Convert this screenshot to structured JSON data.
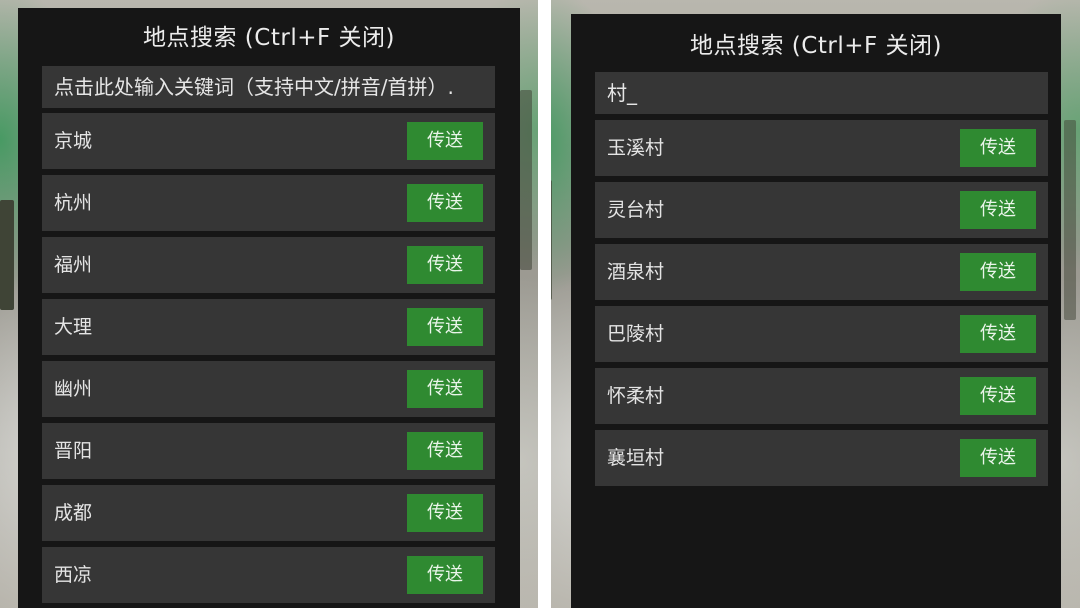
{
  "left_panel": {
    "title": "地点搜索 (Ctrl+F 关闭)",
    "search_text": "点击此处输入关键词（支持中文/拼音/首拼）.",
    "items": [
      {
        "label": "京城",
        "button": "传送"
      },
      {
        "label": "杭州",
        "button": "传送"
      },
      {
        "label": "福州",
        "button": "传送"
      },
      {
        "label": "大理",
        "button": "传送"
      },
      {
        "label": "幽州",
        "button": "传送"
      },
      {
        "label": "晋阳",
        "button": "传送"
      },
      {
        "label": "成都",
        "button": "传送"
      },
      {
        "label": "西凉",
        "button": "传送"
      }
    ]
  },
  "right_panel": {
    "title": "地点搜索 (Ctrl+F 关闭)",
    "search_text": "村_",
    "items": [
      {
        "label": "玉溪村",
        "button": "传送"
      },
      {
        "label": "灵台村",
        "button": "传送"
      },
      {
        "label": "酒泉村",
        "button": "传送"
      },
      {
        "label": "巴陵村",
        "button": "传送"
      },
      {
        "label": "怀柔村",
        "button": "传送"
      },
      {
        "label": "襄垣村",
        "button": "传送"
      }
    ]
  },
  "colors": {
    "panel": "#161616",
    "row": "#363636",
    "button": "#2f8a31"
  }
}
